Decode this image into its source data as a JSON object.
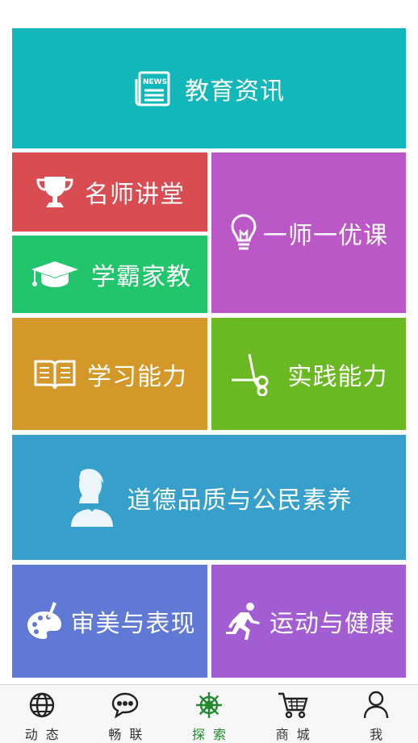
{
  "tiles": {
    "news": {
      "label": "教育资讯",
      "icon": "newspaper-icon",
      "color": "#12b8b9"
    },
    "teacher": {
      "label": "名师讲堂",
      "icon": "trophy-icon",
      "color": "#d94c52"
    },
    "tutor": {
      "label": "学霸家教",
      "icon": "graduation-cap-icon",
      "color": "#21c56b"
    },
    "course": {
      "label": "一师一优课",
      "icon": "lightbulb-icon",
      "color": "#bb57c7"
    },
    "learn": {
      "label": "学习能力",
      "icon": "open-book-icon",
      "color": "#d49828"
    },
    "practice": {
      "label": "实践能力",
      "icon": "scissors-icon",
      "color": "#6bb922"
    },
    "moral": {
      "label": "道德品质与公民素养",
      "icon": "bust-portrait-icon",
      "color": "#369fcc"
    },
    "aesthetic": {
      "label": "审美与表现",
      "icon": "paint-palette-icon",
      "color": "#5f79d5"
    },
    "sport": {
      "label": "运动与健康",
      "icon": "running-person-icon",
      "color": "#a15dd1"
    }
  },
  "tabbar": {
    "items": [
      {
        "label": "动态",
        "icon": "globe-icon"
      },
      {
        "label": "畅联",
        "icon": "chat-bubble-icon"
      },
      {
        "label": "探索",
        "icon": "ship-wheel-icon",
        "active": true
      },
      {
        "label": "商城",
        "icon": "shopping-cart-icon"
      },
      {
        "label": "我",
        "icon": "person-icon"
      }
    ],
    "active_color": "#1f8a2e"
  }
}
